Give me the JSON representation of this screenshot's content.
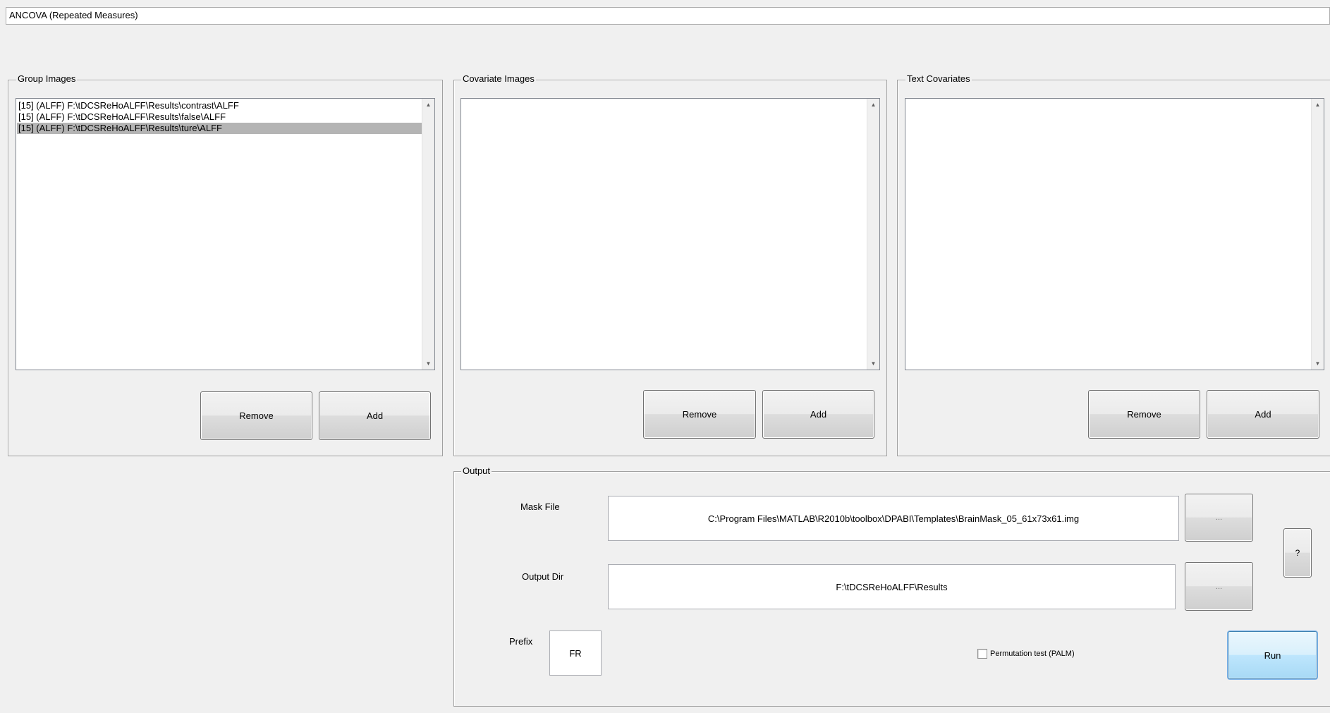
{
  "analysis_type": {
    "selected": "ANCOVA (Repeated Measures)"
  },
  "group_images": {
    "title": "Group Images",
    "items": [
      "[15] (ALFF) F:\\tDCSReHoALFF\\Results\\contrast\\ALFF",
      "[15] (ALFF) F:\\tDCSReHoALFF\\Results\\false\\ALFF",
      "[15] (ALFF) F:\\tDCSReHoALFF\\Results\\ture\\ALFF"
    ],
    "selected_index": 2,
    "remove_label": "Remove",
    "add_label": "Add"
  },
  "covariate_images": {
    "title": "Covariate Images",
    "items": [],
    "remove_label": "Remove",
    "add_label": "Add"
  },
  "text_covariates": {
    "title": "Text Covariates",
    "items": [],
    "remove_label": "Remove",
    "add_label": "Add"
  },
  "output": {
    "title": "Output",
    "mask_file_label": "Mask File",
    "mask_file_value": "C:\\Program Files\\MATLAB\\R2010b\\toolbox\\DPABI\\Templates\\BrainMask_05_61x73x61.img",
    "mask_browse_label": "...",
    "output_dir_label": "Output Dir",
    "output_dir_value": "F:\\tDCSReHoALFF\\Results",
    "output_browse_label": "...",
    "help_label": "?",
    "prefix_label": "Prefix",
    "prefix_value": "FR",
    "permutation_label": "Permutation test (PALM)",
    "permutation_checked": false,
    "run_label": "Run"
  },
  "icons": {
    "scroll_up": "▲",
    "scroll_down": "▼"
  }
}
